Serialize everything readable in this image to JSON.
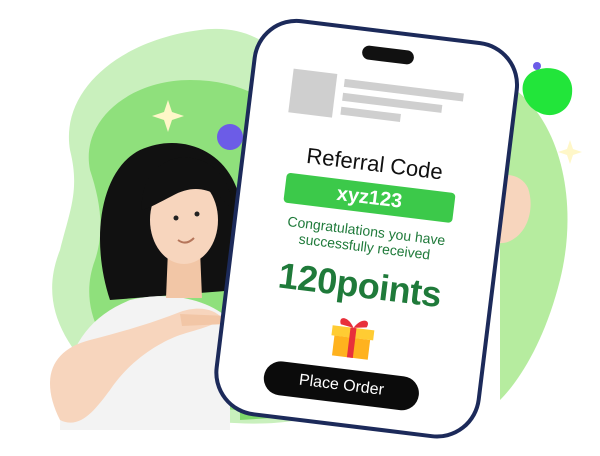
{
  "referral": {
    "title": "Referral Code",
    "code": "xyz123",
    "message_line1": "Congratulations you have",
    "message_line2": "successfully received",
    "points": "120points",
    "button_label": "Place Order"
  },
  "colors": {
    "blob_light": "#c9f0bd",
    "blob_mid": "#8fe07c",
    "blob_dark": "#56c94a",
    "code_bg": "#3cc94a",
    "text_green": "#1f7a3a",
    "phone_border": "#1c2a5a",
    "button_bg": "#0b0b0b",
    "purple_dot": "#6c5ce7",
    "neon_blob": "#22e53a"
  },
  "icons": [
    "sparkle-icon",
    "gift-icon",
    "image-placeholder-icon"
  ]
}
